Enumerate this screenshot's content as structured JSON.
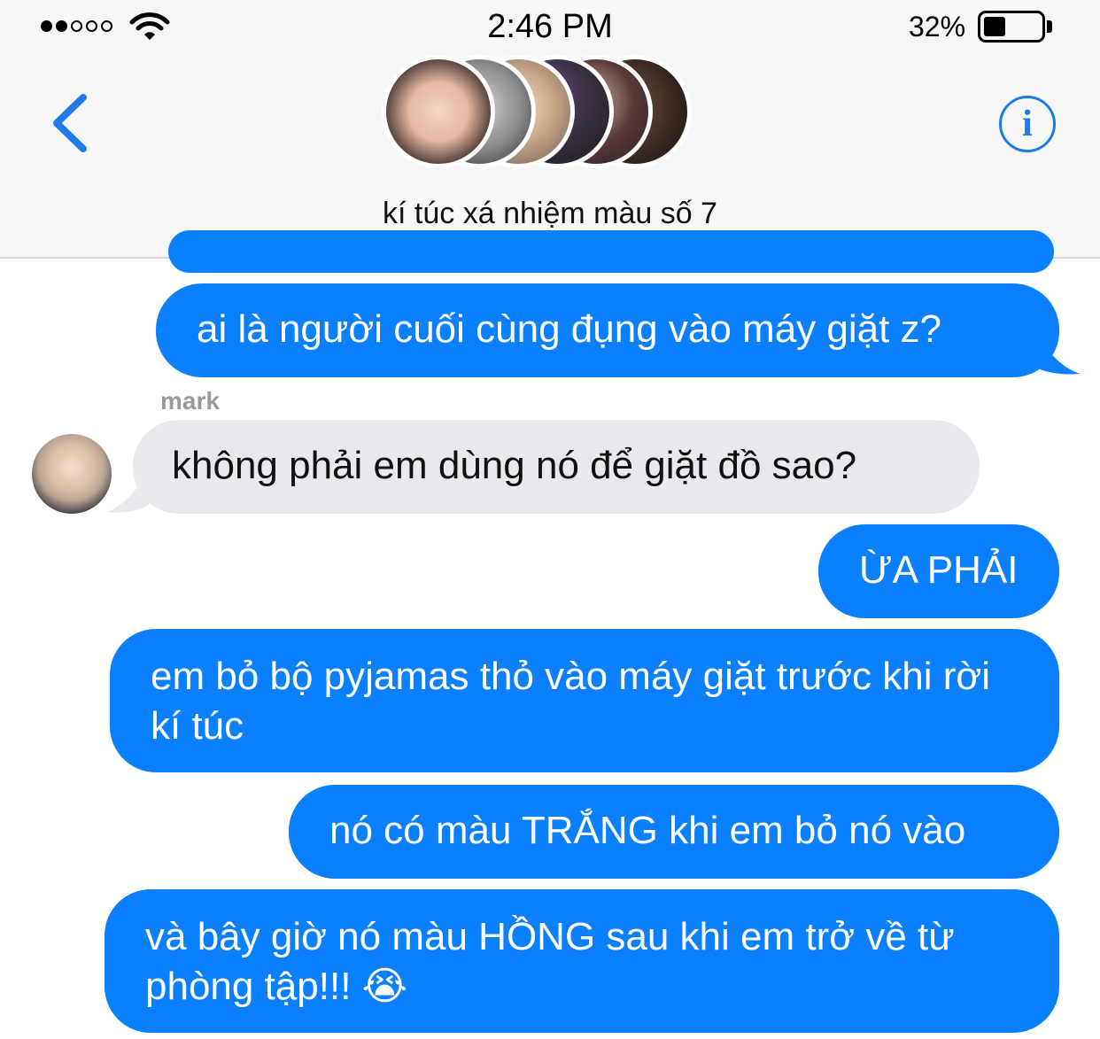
{
  "status_bar": {
    "time": "2:46 PM",
    "battery_percent": "32%",
    "signal_full": 2,
    "signal_total": 5,
    "battery_level": 0.32
  },
  "header": {
    "group_name": "kí túc xá nhiệm màu số 7",
    "back_icon": "chevron-left-icon",
    "info_icon": "info-icon",
    "avatar_count": 5,
    "accent_color": "#1f7bea"
  },
  "colors": {
    "outgoing_bubble": "#0a80ff",
    "incoming_bubble": "#e9e8ed"
  },
  "messages": [
    {
      "direction": "outgoing",
      "text": "ai là người cuối cùng đụng vào máy giặt z?"
    },
    {
      "direction": "incoming",
      "sender": "mark",
      "text": "không phải em dùng nó để giặt đồ sao?"
    },
    {
      "direction": "outgoing",
      "text": "ỪA PHẢI"
    },
    {
      "direction": "outgoing",
      "text": "em bỏ bộ pyjamas thỏ vào máy giặt trước khi rời kí túc"
    },
    {
      "direction": "outgoing",
      "text": "nó có màu TRẮNG khi em bỏ nó vào"
    },
    {
      "direction": "outgoing",
      "text": "và bây giờ nó màu HỒNG sau khi em trở về từ phòng tập!!! 😭"
    }
  ]
}
